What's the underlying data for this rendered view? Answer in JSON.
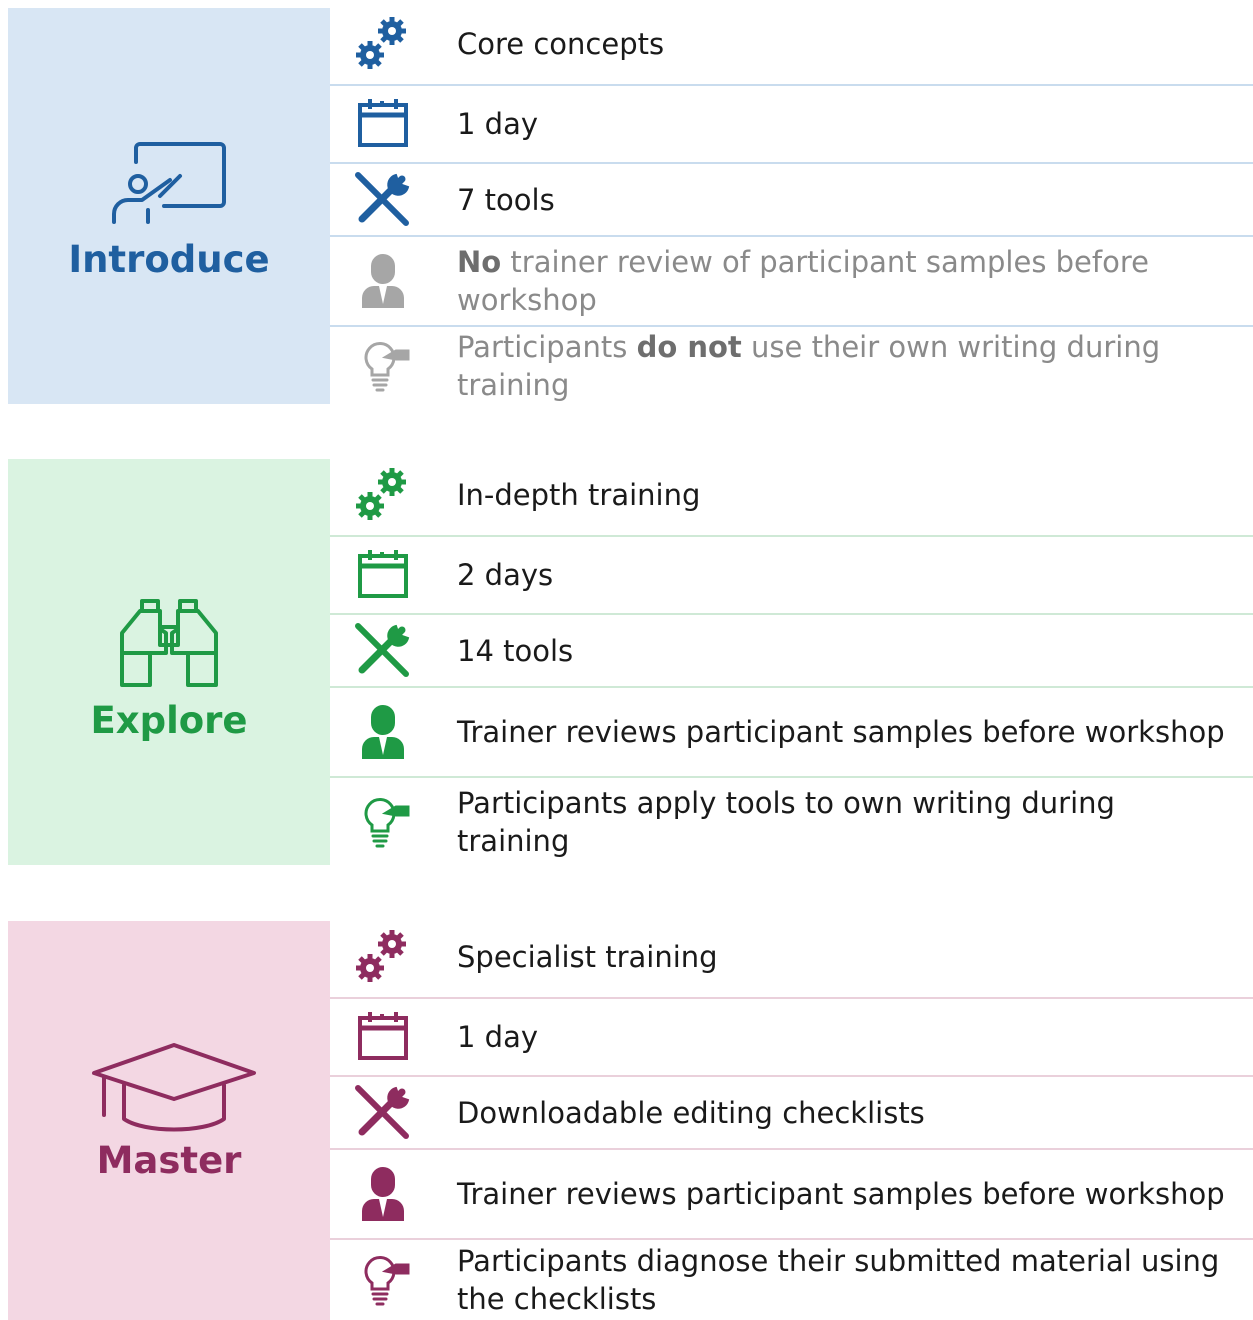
{
  "colors": {
    "introduce": "#1f5fa0",
    "introduce_bg": "#d8e6f4",
    "introduce_line": "#c9dcee",
    "explore": "#1f9a45",
    "explore_bg": "#daf3e1",
    "explore_line": "#cfe9d6",
    "master": "#8e2c5f",
    "master_bg": "#f3d7e3",
    "master_line": "#ead0db",
    "muted": "#a6a6a6"
  },
  "introduce": {
    "label": "Introduce",
    "icon": "teacher-whiteboard-icon",
    "rows": [
      {
        "icon": "gears-icon",
        "text": "Core concepts"
      },
      {
        "icon": "calendar-icon",
        "text": "1 day"
      },
      {
        "icon": "tools-icon",
        "text": "7 tools"
      },
      {
        "icon": "trainer-icon",
        "bold": "No",
        "text": " trainer review of participant samples before workshop"
      },
      {
        "icon": "lightbulb-icon",
        "text_before": "Participants ",
        "bold": "do not",
        "text": " use their own writing during training"
      }
    ]
  },
  "explore": {
    "label": "Explore",
    "icon": "binoculars-icon",
    "rows": [
      {
        "icon": "gears-icon",
        "text": "In-depth training"
      },
      {
        "icon": "calendar-icon",
        "text": "2 days"
      },
      {
        "icon": "tools-icon",
        "text": "14 tools"
      },
      {
        "icon": "trainer-icon",
        "text": "Trainer reviews participant samples before workshop"
      },
      {
        "icon": "lightbulb-icon",
        "text": "Participants apply tools to own writing during training"
      }
    ]
  },
  "master": {
    "label": "Master",
    "icon": "graduation-cap-icon",
    "rows": [
      {
        "icon": "gears-icon",
        "text": "Specialist training"
      },
      {
        "icon": "calendar-icon",
        "text": "1 day"
      },
      {
        "icon": "tools-icon",
        "text": "Downloadable editing checklists"
      },
      {
        "icon": "trainer-icon",
        "text": "Trainer reviews participant samples before workshop"
      },
      {
        "icon": "lightbulb-icon",
        "text": "Participants diagnose their submitted material using the checklists"
      }
    ]
  }
}
